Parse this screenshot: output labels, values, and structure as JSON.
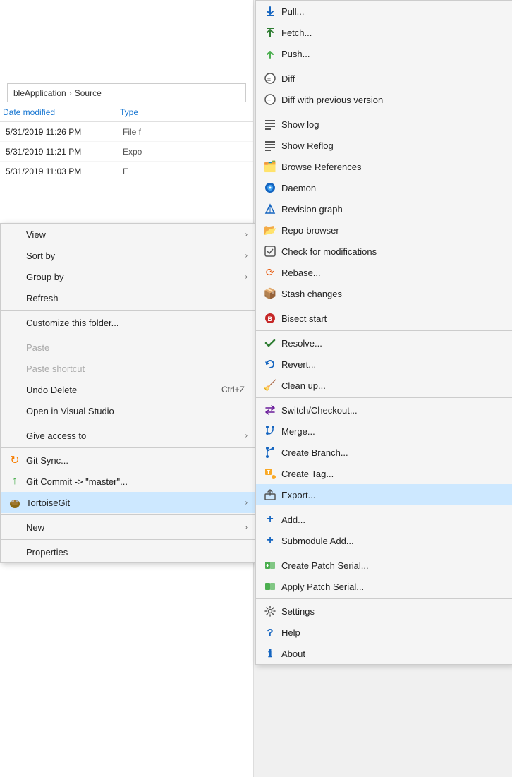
{
  "explorer": {
    "breadcrumb": [
      "bleApplication",
      "Source"
    ],
    "columns": {
      "date": "Date modified",
      "type": "Type"
    },
    "files": [
      {
        "date": "5/31/2019 11:26 PM",
        "type": "File f"
      },
      {
        "date": "5/31/2019 11:21 PM",
        "type": "Expo"
      },
      {
        "date": "5/31/2019 11:03 PM",
        "type": "E"
      }
    ]
  },
  "left_menu": {
    "items": [
      {
        "id": "view",
        "label": "View",
        "has_arrow": true,
        "disabled": false,
        "icon": ""
      },
      {
        "id": "sort_by",
        "label": "Sort by",
        "has_arrow": true,
        "disabled": false,
        "icon": ""
      },
      {
        "id": "group_by",
        "label": "Group by",
        "has_arrow": true,
        "disabled": false,
        "icon": ""
      },
      {
        "id": "refresh",
        "label": "Refresh",
        "has_arrow": false,
        "disabled": false,
        "icon": ""
      },
      {
        "id": "sep1",
        "type": "separator"
      },
      {
        "id": "customize",
        "label": "Customize this folder...",
        "has_arrow": false,
        "disabled": false,
        "icon": ""
      },
      {
        "id": "sep2",
        "type": "separator"
      },
      {
        "id": "paste",
        "label": "Paste",
        "has_arrow": false,
        "disabled": true,
        "icon": ""
      },
      {
        "id": "paste_shortcut",
        "label": "Paste shortcut",
        "has_arrow": false,
        "disabled": true,
        "icon": ""
      },
      {
        "id": "undo_delete",
        "label": "Undo Delete",
        "shortcut": "Ctrl+Z",
        "has_arrow": false,
        "disabled": false,
        "icon": ""
      },
      {
        "id": "open_vs",
        "label": "Open in Visual Studio",
        "has_arrow": false,
        "disabled": false,
        "icon": ""
      },
      {
        "id": "sep3",
        "type": "separator"
      },
      {
        "id": "give_access",
        "label": "Give access to",
        "has_arrow": true,
        "disabled": false,
        "icon": ""
      },
      {
        "id": "sep4",
        "type": "separator"
      },
      {
        "id": "git_sync",
        "label": "Git Sync...",
        "has_arrow": false,
        "disabled": false,
        "icon": "git_sync"
      },
      {
        "id": "git_commit",
        "label": "Git Commit -> \"master\"...",
        "has_arrow": false,
        "disabled": false,
        "icon": "git_commit"
      },
      {
        "id": "tortoisegit",
        "label": "TortoiseGit",
        "has_arrow": true,
        "disabled": false,
        "icon": "tortoisegit",
        "highlighted": true
      },
      {
        "id": "sep5",
        "type": "separator"
      },
      {
        "id": "new",
        "label": "New",
        "has_arrow": true,
        "disabled": false,
        "icon": ""
      },
      {
        "id": "sep6",
        "type": "separator"
      },
      {
        "id": "properties",
        "label": "Properties",
        "has_arrow": false,
        "disabled": false,
        "icon": ""
      }
    ]
  },
  "right_menu": {
    "items": [
      {
        "id": "pull",
        "label": "Pull...",
        "icon": "pull"
      },
      {
        "id": "fetch",
        "label": "Fetch...",
        "icon": "fetch"
      },
      {
        "id": "push",
        "label": "Push...",
        "icon": "push"
      },
      {
        "id": "sep1",
        "type": "separator"
      },
      {
        "id": "diff",
        "label": "Diff",
        "icon": "diff"
      },
      {
        "id": "diff_prev",
        "label": "Diff with previous version",
        "icon": "diff"
      },
      {
        "id": "sep2",
        "type": "separator"
      },
      {
        "id": "show_log",
        "label": "Show log",
        "icon": "log"
      },
      {
        "id": "show_reflog",
        "label": "Show Reflog",
        "icon": "log"
      },
      {
        "id": "browse_ref",
        "label": "Browse References",
        "icon": "browse"
      },
      {
        "id": "daemon",
        "label": "Daemon",
        "icon": "globe"
      },
      {
        "id": "revision",
        "label": "Revision graph",
        "icon": "revision"
      },
      {
        "id": "repo_browser",
        "label": "Repo-browser",
        "icon": "repo"
      },
      {
        "id": "check_mod",
        "label": "Check for modifications",
        "icon": "check"
      },
      {
        "id": "rebase",
        "label": "Rebase...",
        "icon": "rebase"
      },
      {
        "id": "stash",
        "label": "Stash changes",
        "icon": "stash"
      },
      {
        "id": "sep3",
        "type": "separator"
      },
      {
        "id": "bisect",
        "label": "Bisect start",
        "icon": "bisect"
      },
      {
        "id": "sep4",
        "type": "separator"
      },
      {
        "id": "resolve",
        "label": "Resolve...",
        "icon": "resolve"
      },
      {
        "id": "revert",
        "label": "Revert...",
        "icon": "revert"
      },
      {
        "id": "cleanup",
        "label": "Clean up...",
        "icon": "clean"
      },
      {
        "id": "sep5",
        "type": "separator"
      },
      {
        "id": "switch",
        "label": "Switch/Checkout...",
        "icon": "switch"
      },
      {
        "id": "merge",
        "label": "Merge...",
        "icon": "merge"
      },
      {
        "id": "branch",
        "label": "Create Branch...",
        "icon": "branch"
      },
      {
        "id": "tag",
        "label": "Create Tag...",
        "icon": "tag"
      },
      {
        "id": "export",
        "label": "Export...",
        "icon": "export",
        "highlighted": true
      },
      {
        "id": "sep6",
        "type": "separator"
      },
      {
        "id": "add",
        "label": "Add...",
        "icon": "add"
      },
      {
        "id": "submodule",
        "label": "Submodule Add...",
        "icon": "submodule"
      },
      {
        "id": "sep7",
        "type": "separator"
      },
      {
        "id": "patch_serial",
        "label": "Create Patch Serial...",
        "icon": "patch"
      },
      {
        "id": "apply_patch",
        "label": "Apply Patch Serial...",
        "icon": "apply"
      },
      {
        "id": "sep8",
        "type": "separator"
      },
      {
        "id": "settings",
        "label": "Settings",
        "icon": "settings"
      },
      {
        "id": "help",
        "label": "Help",
        "icon": "help"
      },
      {
        "id": "about",
        "label": "About",
        "icon": "about"
      }
    ]
  }
}
